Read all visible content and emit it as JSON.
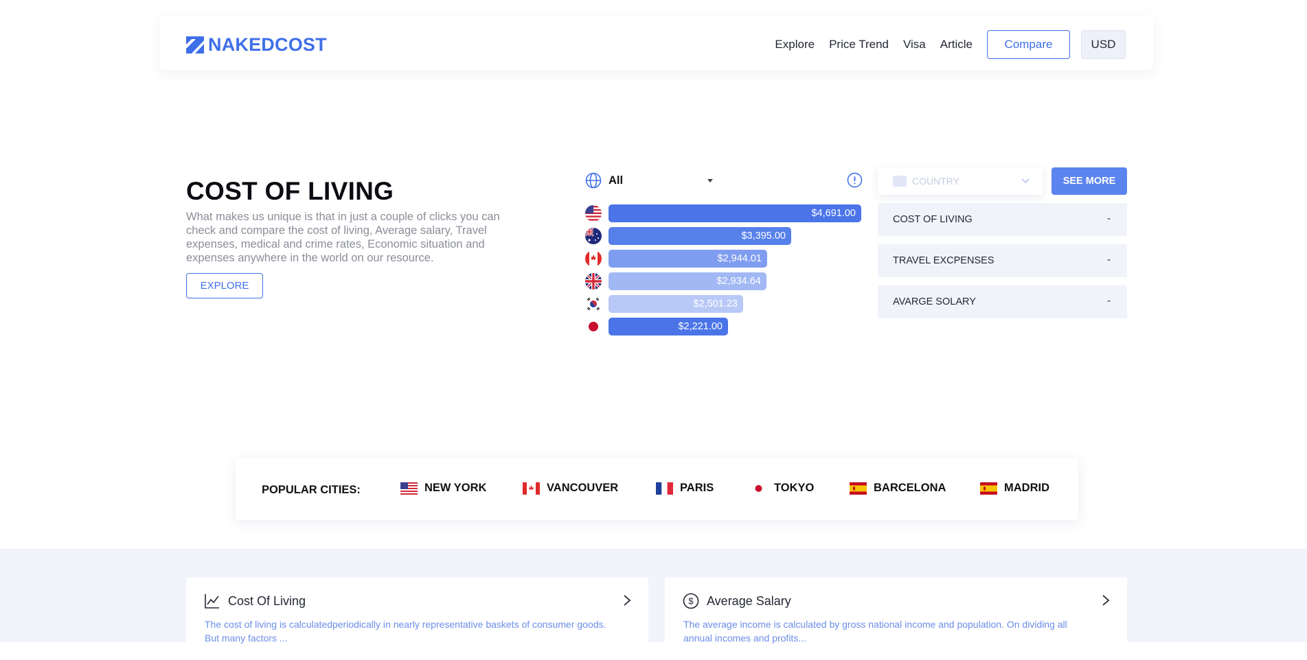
{
  "header": {
    "logo_text": "NAKEDCOST",
    "nav": [
      "Explore",
      "Price Trend",
      "Visa",
      "Article"
    ],
    "compare_label": "Compare",
    "currency_label": "USD"
  },
  "hero": {
    "title": "COST OF LIVING",
    "description": "What makes us unique is that in just a couple of clicks you can check and compare the cost of living, Average salary, Travel expenses, medical and crime rates, Economic situation and expenses anywhere in the world on our resource.",
    "explore_label": "EXPLORE"
  },
  "chart_filter": {
    "value": "All"
  },
  "chart_data": {
    "type": "bar",
    "orientation": "horizontal",
    "categories": [
      "United States",
      "Australia",
      "Canada",
      "United Kingdom",
      "South Korea",
      "Japan"
    ],
    "values": [
      4691.0,
      3395.0,
      2944.01,
      2934.64,
      2501.23,
      2221.0
    ],
    "labels": [
      "$4,691.00",
      "$3,395.00",
      "$2,944.01",
      "$2,934.64",
      "$2,501.23",
      "$2,221.00"
    ],
    "bar_colors": [
      "#4a74e8",
      "#5680ea",
      "#7f9df0",
      "#a2b8f4",
      "#b9c9f7",
      "#4a74e8"
    ],
    "flag_icons": [
      "us-flag-icon",
      "australia-flag-icon",
      "canada-flag-icon",
      "uk-flag-icon",
      "south-korea-flag-icon",
      "japan-flag-icon"
    ]
  },
  "right_panel": {
    "country_placeholder": "COUNTRY",
    "see_more_label": "SEE MORE",
    "stats": [
      {
        "label": "COST OF LIVING",
        "value": "-"
      },
      {
        "label": "TRAVEL EXCPENSES",
        "value": "-"
      },
      {
        "label": "AVARGE SOLARY",
        "value": "-"
      }
    ]
  },
  "popular": {
    "label": "POPULAR CITIES:",
    "cities": [
      {
        "name": "NEW YORK",
        "flag": "us-flag-icon"
      },
      {
        "name": "VANCOUVER",
        "flag": "canada-flag-icon"
      },
      {
        "name": "PARIS",
        "flag": "france-flag-icon"
      },
      {
        "name": "TOKYO",
        "flag": "japan-flag-icon"
      },
      {
        "name": "BARCELONA",
        "flag": "spain-flag-icon"
      },
      {
        "name": "MADRID",
        "flag": "spain-flag-icon"
      }
    ]
  },
  "cards": [
    {
      "title": "Cost Of Living",
      "icon": "line-chart-icon",
      "desc": "The cost of living is calculatedperiodically in nearly representative baskets of consumer goods. But many factors ..."
    },
    {
      "title": "Average Salary",
      "icon": "dollar-circle-icon",
      "desc": "The average income is calculated by gross national income and population. On dividing all annual incomes and profits..."
    }
  ],
  "colors": {
    "accent": "#3f6fe8",
    "see_more": "#5b84ee",
    "panel_bg": "#f1f3fb",
    "section_bg": "#f2f4fc"
  }
}
